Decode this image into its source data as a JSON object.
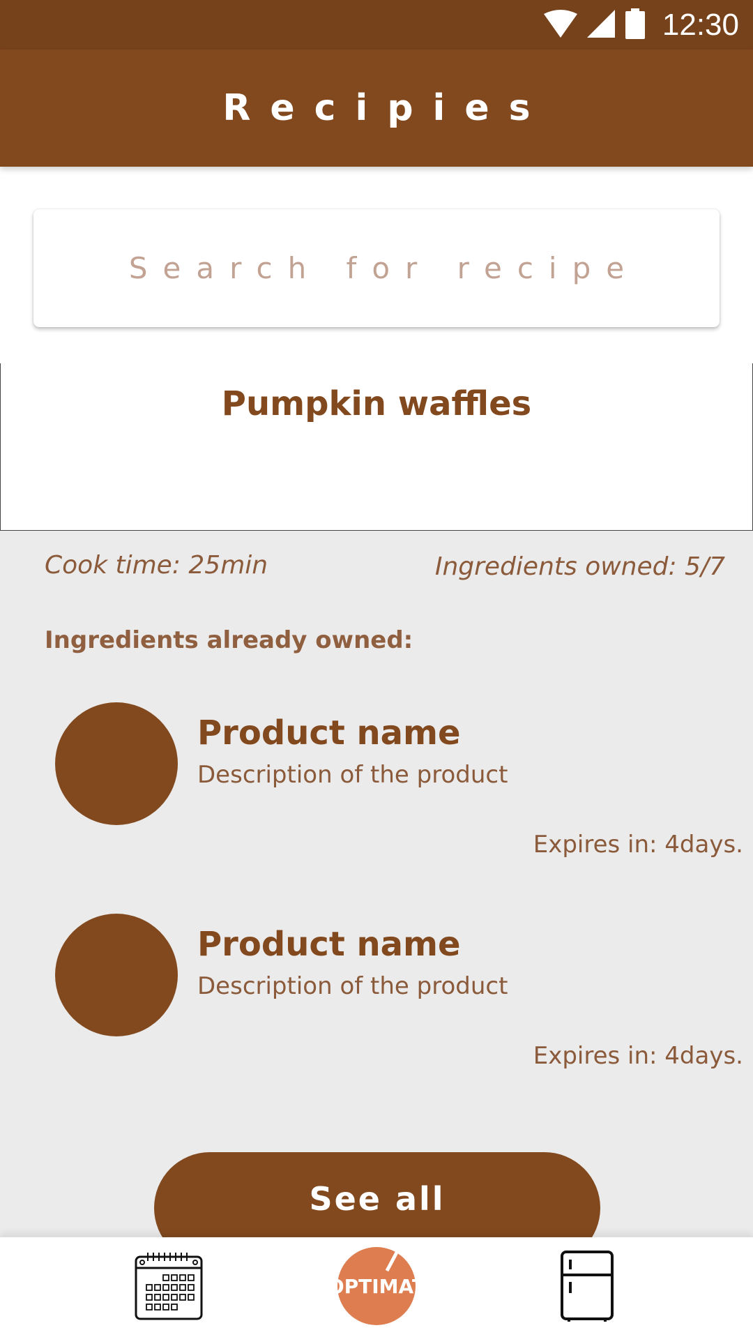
{
  "status_bar": {
    "time": "12:30",
    "icons": [
      "wifi-icon",
      "signal-icon",
      "battery-icon"
    ]
  },
  "app_bar": {
    "title": "Recipies"
  },
  "search": {
    "placeholder": "Search for recipe"
  },
  "recipe": {
    "title": "Pumpkin waffles",
    "cook_time": "Cook time: 25min",
    "ingredients_owned": "Ingredients owned: 5/7",
    "section_heading": "Ingredients already owned:"
  },
  "products": [
    {
      "name": "Product name",
      "description": "Description of the product",
      "expiry": "Expires in: 4days."
    },
    {
      "name": "Product name",
      "description": "Description of the product",
      "expiry": "Expires in: 4days."
    }
  ],
  "actions": {
    "see_all_label": "See all"
  },
  "bottom_nav": {
    "items": [
      {
        "icon": "calendar-icon"
      },
      {
        "icon": "optimat-logo",
        "label": "OPTIMAT"
      },
      {
        "icon": "fridge-icon"
      }
    ]
  },
  "colors": {
    "status_bar": "#76421b",
    "primary": "#82491e",
    "background": "#ebebeb",
    "logo": "#de7d4f"
  }
}
